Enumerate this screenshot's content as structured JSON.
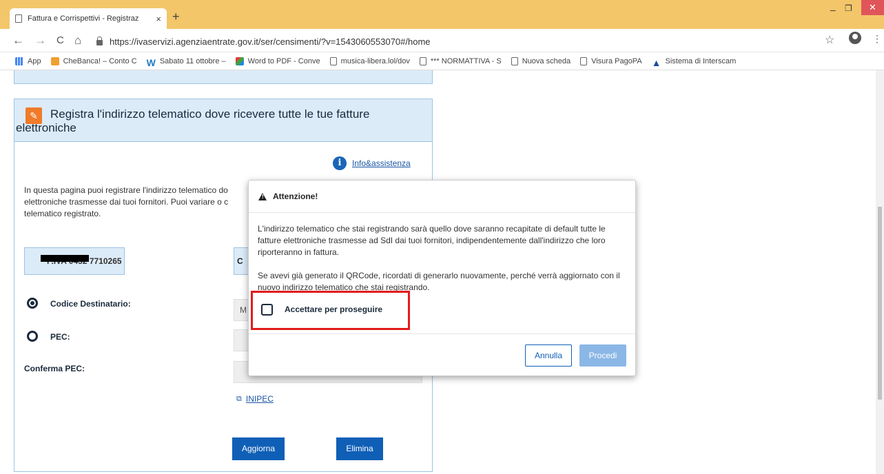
{
  "browser": {
    "tab_title": "Fattura e Corrispettivi - Registraz",
    "tab_close": "×",
    "new_tab": "+",
    "url": "https://ivaservizi.agenziaentrate.gov.it/ser/censimenti/?v=1543060553070#/home",
    "win_min": "–",
    "win_max": "❐",
    "win_close": "✕",
    "back": "←",
    "forward": "→",
    "reload": "C",
    "home": "⌂",
    "star": "☆",
    "menu": "⋮"
  },
  "bookmarks": [
    {
      "label": "App"
    },
    {
      "label": "CheBanca! – Conto C"
    },
    {
      "label": "Sabato 11 ottobre –"
    },
    {
      "label": "Word to PDF - Conve"
    },
    {
      "label": "musica-libera.lol/dov"
    },
    {
      "label": "*** NORMATTIVA - S"
    },
    {
      "label": "Nuova scheda"
    },
    {
      "label": "Visura PagoPA"
    },
    {
      "label": "Sistema di Interscam"
    }
  ],
  "panel": {
    "title": "Registra l'indirizzo telematico dove ricevere tutte le tue fatture elettroniche",
    "info_label": "Info&assistenza",
    "intro": "In questa pagina puoi registrare l'indirizzo telematico do elettroniche trasmesse dai tuoi fornitori. Puoi variare o c telematico registrato.",
    "piva": "P.IVA 0452 7710265",
    "cod_box": "C",
    "codice_label": "Codice Destinatario:",
    "codice_value": "M",
    "pec_label": "PEC:",
    "conferma_label": "Conferma PEC:",
    "inipec": "INIPEC",
    "aggiorna": "Aggiorna",
    "elimina": "Elimina"
  },
  "modal": {
    "title": "Attenzione!",
    "p1": "L'indirizzo telematico che stai registrando sarà quello dove saranno recapitate di default tutte le fatture elettroniche trasmesse ad SdI dai tuoi fornitori, indipendentemente dall'indirizzo che loro riporteranno in fattura.",
    "p2": "Se avevi già generato il QRCode, ricordati di generarlo nuovamente, perché verrà aggiornato con il nuovo indirizzo telematico che stai registrando.",
    "accept": "Accettare per proseguire",
    "annulla": "Annulla",
    "procedi": "Procedi"
  },
  "colors": {
    "titlebar": "#f3c66a",
    "primary": "#0f5fb7",
    "highlight": "#e21b1b"
  }
}
